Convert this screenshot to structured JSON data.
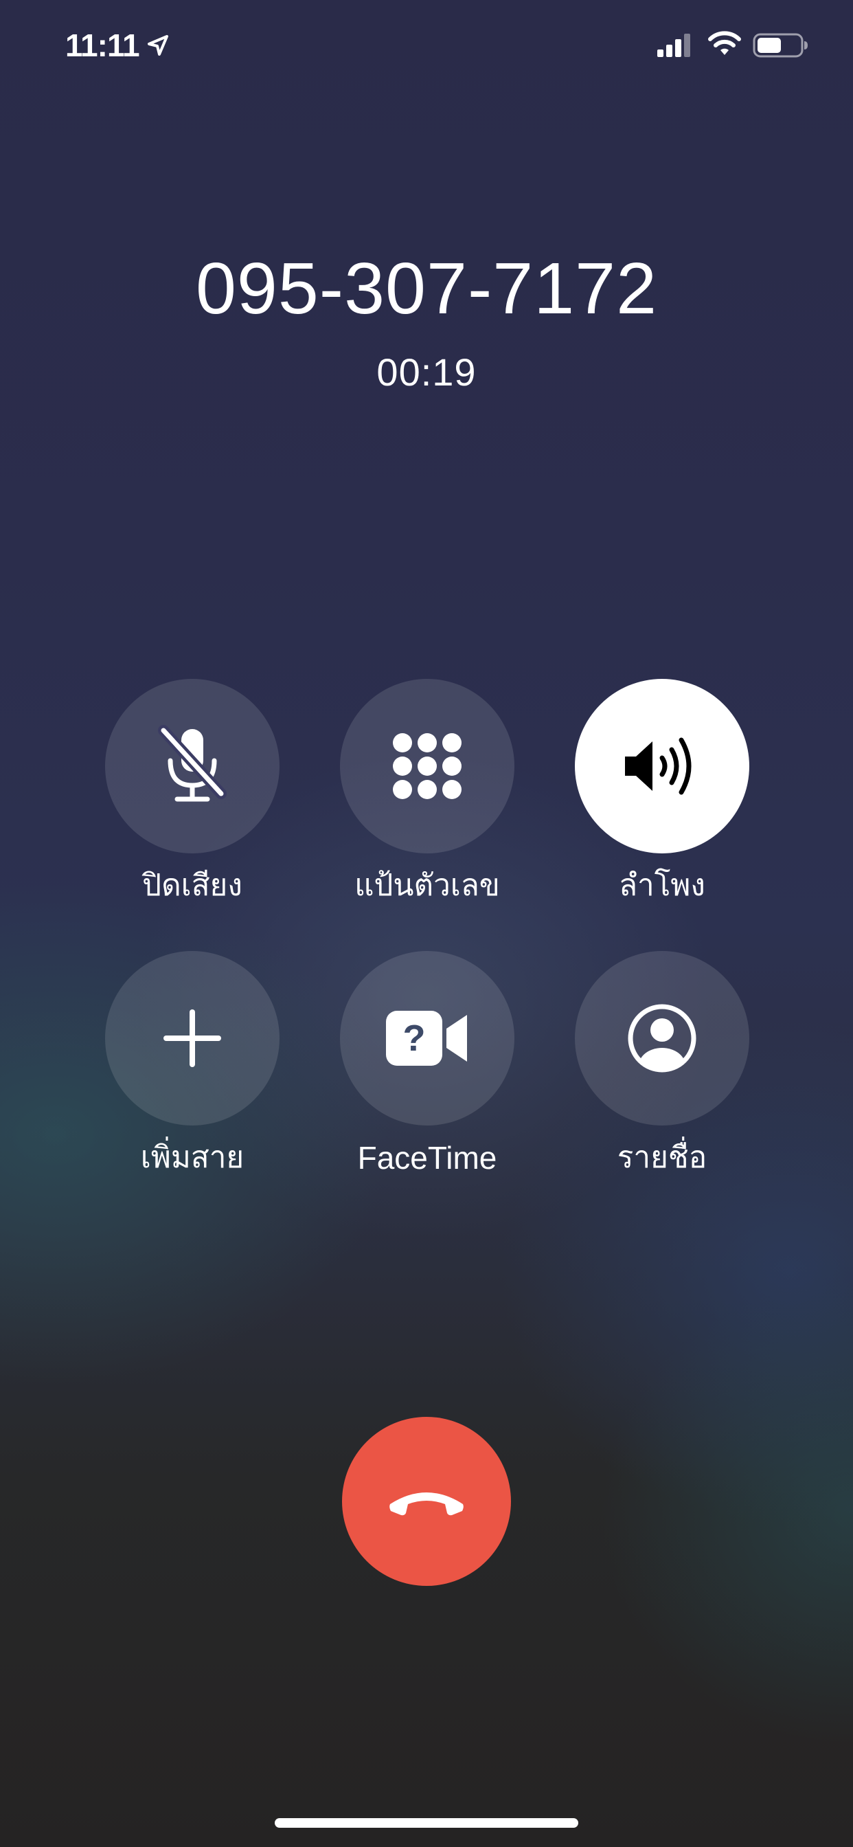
{
  "status_bar": {
    "time": "11:11",
    "location_icon": "location-arrow-icon",
    "signal_icon": "cellular-signal-icon",
    "wifi_icon": "wifi-icon",
    "battery_icon": "battery-icon"
  },
  "call": {
    "number": "095-307-7172",
    "duration": "00:19"
  },
  "controls": [
    {
      "label": "ปิดเสียง",
      "icon": "mic-slash-icon",
      "active": false
    },
    {
      "label": "แป้นตัวเลข",
      "icon": "keypad-icon",
      "active": false
    },
    {
      "label": "ลำโพง",
      "icon": "speaker-icon",
      "active": true
    },
    {
      "label": "เพิ่มสาย",
      "icon": "plus-icon",
      "active": false
    },
    {
      "label": "FaceTime",
      "icon": "facetime-video-icon",
      "active": false
    },
    {
      "label": "รายชื่อ",
      "icon": "contact-icon",
      "active": false
    }
  ],
  "end_call": {
    "icon": "hang-up-icon",
    "color": "#eb5545"
  },
  "colors": {
    "control_bg": "rgba(255,255,255,0.12)",
    "control_active_bg": "#ffffff",
    "end_call": "#eb5545"
  }
}
